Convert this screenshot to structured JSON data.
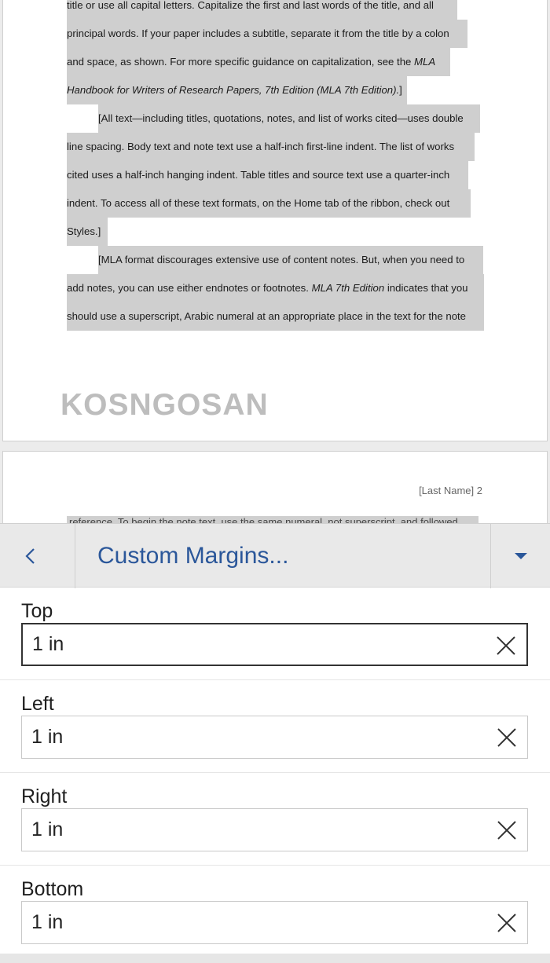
{
  "document": {
    "paragraphs": [
      {
        "lines": [
          "title or use all capital letters. Capitalize the first and last words of the title, and all",
          "principal words. If your paper includes a subtitle, separate it from the title by a colon",
          "and space, as shown. For more specific guidance on capitalization, see the MLA",
          "Handbook for Writers of Research Papers, 7th Edition (MLA 7th Edition).]"
        ]
      },
      {
        "lines": [
          "[All text—including titles, quotations, notes, and list of works cited—uses double",
          "line spacing. Body text and note text use a half-inch first-line indent. The list of works",
          "cited uses a half-inch hanging indent. Table titles and source text use a quarter-inch",
          "indent. To access all of these text formats, on the Home tab of the ribbon, check out",
          "Styles.]"
        ]
      },
      {
        "lines": [
          "[MLA format discourages extensive use of content notes. But, when you need to",
          "add notes, you can use either endnotes or footnotes. MLA 7th Edition indicates that you",
          "should use a superscript, Arabic numeral at an appropriate place in the text for the note"
        ]
      }
    ],
    "watermark": "KOSNGOSAN",
    "page2_header": "[Last Name] 2",
    "page2_cut_line": "reference. To begin the note text, use the same numeral, not superscript, and followed"
  },
  "panel": {
    "title": "Custom Margins...",
    "fields": [
      {
        "label": "Top",
        "value": "1 in",
        "active": true
      },
      {
        "label": "Left",
        "value": "1 in",
        "active": false
      },
      {
        "label": "Right",
        "value": "1 in",
        "active": false
      },
      {
        "label": "Bottom",
        "value": "1 in",
        "active": false
      }
    ]
  },
  "icons": {
    "back": "chevron-left-icon",
    "dropdown": "caret-down-icon",
    "clear": "close-icon"
  },
  "colors": {
    "accent": "#2b579a",
    "highlight": "#cfcfcf"
  }
}
